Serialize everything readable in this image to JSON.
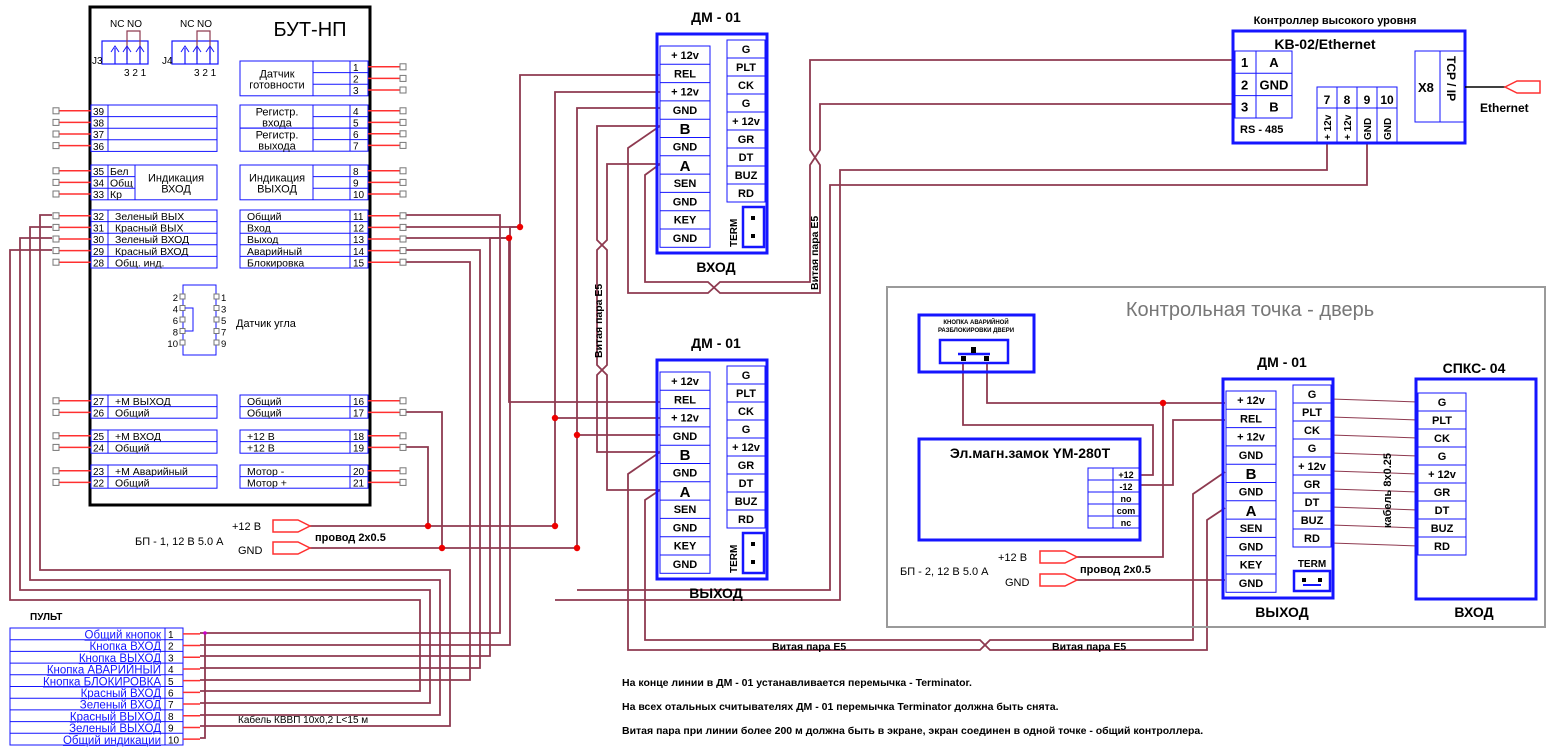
{
  "colors": {
    "frame_blue": "#1515ff",
    "pin_red": "#ff3030",
    "wire_maroon": "#8e3a50",
    "zone_gray": "#9a9a9a"
  },
  "but_np": {
    "title": "БУТ-НП",
    "jumpers": [
      {
        "label": "J3",
        "nc": "NC",
        "no": "NO",
        "pins": "3 2 1"
      },
      {
        "label": "J4",
        "nc": "NC",
        "no": "NO",
        "pins": "3 2 1"
      }
    ],
    "right_groups": [
      {
        "merged": [
          "Датчик",
          "готовности"
        ],
        "rows": [
          [
            "",
            "1"
          ],
          [
            "",
            "2"
          ],
          [
            "",
            "3"
          ]
        ]
      },
      {
        "merged": [
          "Регистр.",
          "входа"
        ],
        "rows": [
          [
            "",
            "4"
          ],
          [
            "",
            "5"
          ]
        ]
      },
      {
        "merged": [
          "Регистр.",
          "выхода"
        ],
        "rows": [
          [
            "",
            "6"
          ],
          [
            "",
            "7"
          ]
        ]
      },
      {
        "merged": [
          "Индикация",
          "ВЫХОД"
        ],
        "rows": [
          [
            "",
            "8"
          ],
          [
            "",
            "9"
          ],
          [
            "",
            "10"
          ]
        ]
      },
      {
        "rows": [
          [
            "Общий",
            "11"
          ],
          [
            "Вход",
            "12"
          ],
          [
            "Выход",
            "13"
          ],
          [
            "Аварийный",
            "14"
          ],
          [
            "Блокировка",
            "15"
          ]
        ]
      },
      {
        "rows": [
          [
            "Общий",
            "16"
          ],
          [
            "Общий",
            "17"
          ]
        ]
      },
      {
        "rows": [
          [
            "+12 В",
            "18"
          ],
          [
            "+12 В",
            "19"
          ]
        ]
      },
      {
        "rows": [
          [
            "Мотор -",
            "20"
          ],
          [
            "Мотор +",
            "21"
          ]
        ]
      }
    ],
    "left_groups": [
      {
        "rows": [
          [
            "39",
            ""
          ],
          [
            "38",
            ""
          ],
          [
            "37",
            ""
          ],
          [
            "36",
            ""
          ]
        ]
      },
      {
        "merged": [
          "Индикация",
          "ВХОД"
        ],
        "rows": [
          [
            "35",
            "Бел"
          ],
          [
            "34",
            "Общ"
          ],
          [
            "33",
            "Кр"
          ]
        ]
      },
      {
        "rows": [
          [
            "32",
            "Зеленый ВЫХ"
          ],
          [
            "31",
            "Красный ВЫХ"
          ],
          [
            "30",
            "Зеленый ВХОД"
          ],
          [
            "29",
            "Красный ВХОД"
          ],
          [
            "28",
            "Общ. инд."
          ]
        ]
      },
      {
        "rows": [
          [
            "27",
            "+М ВЫХОД"
          ],
          [
            "26",
            "Общий"
          ]
        ]
      },
      {
        "rows": [
          [
            "25",
            "+М ВХОД"
          ],
          [
            "24",
            "Общий"
          ]
        ]
      },
      {
        "rows": [
          [
            "23",
            "+М Аварийный"
          ],
          [
            "22",
            "Общий"
          ]
        ]
      }
    ],
    "angle_sensor": {
      "label": "Датчик угла",
      "left_pins": [
        "2",
        "4",
        "6",
        "8",
        "10"
      ],
      "right_pins": [
        "1",
        "3",
        "5",
        "7",
        "9"
      ]
    }
  },
  "psu1": {
    "name": "БП - 1, 12 В 5.0 А",
    "plus": "+12 В",
    "gnd": "GND",
    "wire": "провод 2x0.5"
  },
  "psu2": {
    "name": "БП - 2, 12 В 5.0 А",
    "plus": "+12 В",
    "gnd": "GND",
    "wire": "провод 2x0.5"
  },
  "pult": {
    "title": "ПУЛЬТ",
    "rows": [
      [
        "Общий кнопок",
        "1"
      ],
      [
        "Кнопка ВХОД",
        "2"
      ],
      [
        "Кнопка ВЫХОД",
        "3"
      ],
      [
        "Кнопка АВАРИЙНЫЙ",
        "4"
      ],
      [
        "Кнопка БЛОКИРОВКА",
        "5"
      ],
      [
        "Красный ВХОД",
        "6"
      ],
      [
        "Зеленый ВХОД",
        "7"
      ],
      [
        "Красный ВЫХОД",
        "8"
      ],
      [
        "Зеленый ВЫХОД",
        "9"
      ],
      [
        "Общий индикации",
        "10"
      ]
    ],
    "cable": "Кабель КВВП 10x0,2  L<15 м"
  },
  "dm01": {
    "title": "ДМ - 01",
    "left": [
      "+ 12v",
      "REL",
      "+ 12v",
      "GND",
      "B",
      "GND",
      "A",
      "SEN",
      "GND",
      "KEY",
      "GND"
    ],
    "right": [
      "G",
      "PLT",
      "CK",
      "G",
      "+ 12v",
      "GR",
      "DT",
      "BUZ",
      "RD"
    ],
    "term": "TERM",
    "instances": [
      {
        "caption": "ВХОД"
      },
      {
        "caption": "ВЫХОД"
      },
      {
        "caption": "ВЫХОД"
      }
    ]
  },
  "twisted_pair": "Витая пара  E5",
  "kv02": {
    "header": "Контроллер высокого уровня",
    "title": "KB-02/Ethernet",
    "rs485": [
      [
        "1",
        "A"
      ],
      [
        "2",
        "GND"
      ],
      [
        "3",
        "B"
      ]
    ],
    "rs485_label": "RS - 485",
    "ports": [
      [
        "7",
        "+ 12v"
      ],
      [
        "8",
        "+ 12v"
      ],
      [
        "9",
        "GND"
      ],
      [
        "10",
        "GND"
      ]
    ],
    "x8": "X8",
    "tcp": "TCP / IP",
    "ethernet": "Ethernet"
  },
  "door_zone": {
    "title": "Контрольная точка - дверь",
    "button": [
      "КНОПКА АВАРИЙНОЙ",
      "РАЗБЛОКИРОВКИ ДВЕРИ"
    ],
    "lock": {
      "title": "Эл.магн.замок YM-280T",
      "pins": [
        "+12",
        "-12",
        "no",
        "com",
        "nc"
      ]
    },
    "spks": {
      "title": "СПКС- 04",
      "rows": [
        "G",
        "PLT",
        "CK",
        "G",
        "+ 12v",
        "GR",
        "DT",
        "BUZ",
        "RD"
      ],
      "caption": "ВХОД"
    },
    "cable": "кабель 8x0.25"
  },
  "notes": [
    "На конце линии в ДМ - 01 устанавливается перемычка - Terminator.",
    "На всех отальных считывателях ДМ - 01 перемычка Terminator должна быть снята.",
    "Витая пара при линии более 200 м должна быть в экране, экран соединен в одной точке - общий контроллера."
  ]
}
